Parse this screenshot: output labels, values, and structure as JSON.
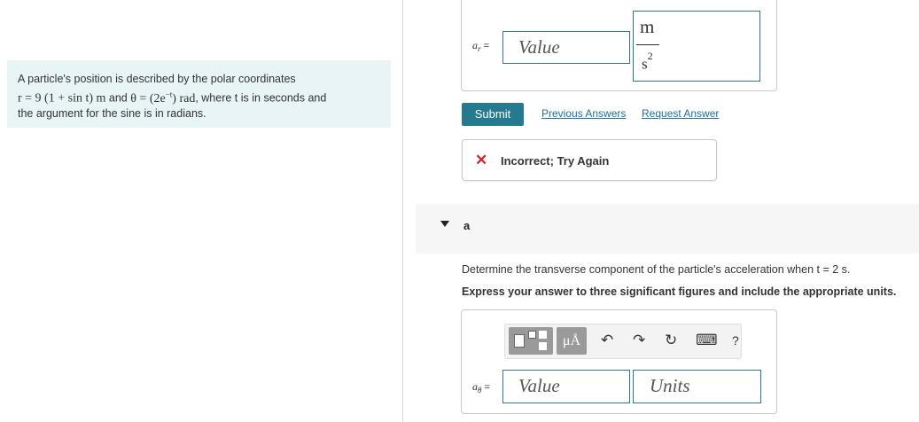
{
  "problem": {
    "text1": "A particle's position is described by the polar coordinates",
    "r_eq": "r = 9 (1 + sin t) m",
    "and": " and ",
    "theta_eq": "θ = (2e",
    "theta_exp": "−t",
    "theta_end": ") rad",
    "text2": ", where t is in seconds and",
    "text3": "the argument for the sine is in radians."
  },
  "prev_part": {
    "label": "a",
    "label_sub": "r",
    "label_eq": " =",
    "value_placeholder": "Value",
    "unit_num": "m",
    "unit_den": "s",
    "unit_den_exp": "2"
  },
  "actions": {
    "submit": "Submit",
    "previous_answers": "Previous Answers",
    "request_answer": "Request Answer"
  },
  "feedback": {
    "icon": "✕",
    "text": "Incorrect; Try Again"
  },
  "part_d": {
    "label": "a",
    "question": "Determine the transverse component of the particle's acceleration when t = 2 s.",
    "instruction": "Express your answer to three significant figures and include the appropriate units.",
    "toolbar": {
      "units_btn": "μÅ",
      "undo": "↶",
      "redo": "↷",
      "reset": "↻",
      "keyboard": "⌨",
      "help": "?"
    },
    "label_sub": "θ",
    "label_eq": " =",
    "value_placeholder": "Value",
    "units_placeholder": "Units"
  }
}
